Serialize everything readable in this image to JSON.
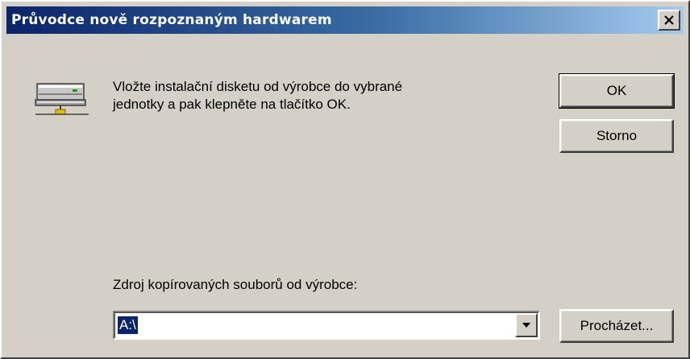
{
  "window": {
    "title": "Průvodce nově rozpoznaným hardwarem",
    "close_icon": "close-icon"
  },
  "message": {
    "icon": "hardware-device-icon",
    "line1": "Vložte instalační disketu od výrobce do vybrané",
    "line2": "jednotky a pak klepněte na tlačítko OK."
  },
  "buttons": {
    "ok": "OK",
    "cancel": "Storno",
    "browse": "Procházet..."
  },
  "source": {
    "label": "Zdroj kopírovaných souborů od výrobce:",
    "value": "A:\\",
    "dropdown_icon": "chevron-down-icon"
  },
  "colors": {
    "title_active": "#0a246a",
    "title_gradient_end": "#a6caf0",
    "dialog_bg": "#d4d0c8",
    "selection": "#0a246a"
  }
}
